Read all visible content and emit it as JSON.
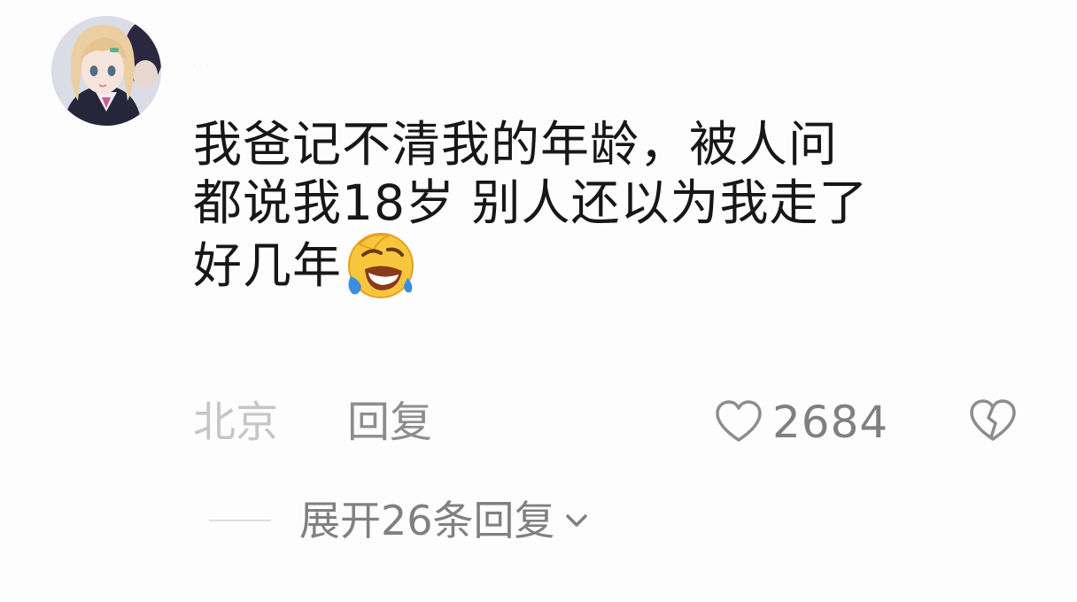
{
  "comment": {
    "username": "· ·",
    "text_lines": [
      "我爸记不清我的年龄，被人问",
      "都说我18岁 别人还以为我走了",
      "好几年"
    ],
    "emoji_icon": "rolling-on-floor-laughing-icon",
    "location": "北京",
    "reply_label": "回复",
    "like_icon": "heart-outline-icon",
    "like_count": "2684",
    "dislike_icon": "broken-heart-outline-icon",
    "avatar_icon": "anime-avatar-icon"
  },
  "replies": {
    "expand_label": "展开26条回复",
    "chevron_icon": "chevron-down-icon"
  },
  "colors": {
    "background": "#fdfdfd",
    "text_primary": "#171717",
    "text_secondary": "#8d8d8d",
    "text_muted": "#c6c6c6"
  }
}
